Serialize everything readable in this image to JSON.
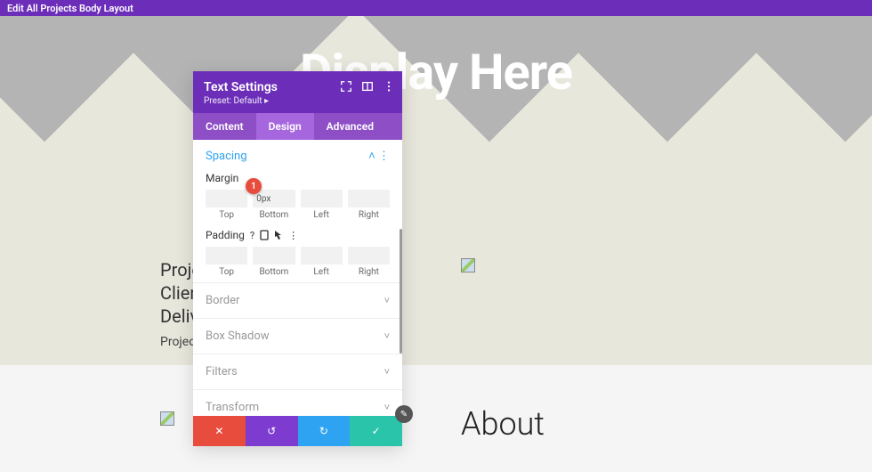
{
  "topBar": {
    "title": "Edit All Projects Body Layout"
  },
  "hero": {
    "title": "Display Here"
  },
  "leftText": {
    "lines": [
      "Projec",
      "Client",
      "Delive"
    ],
    "sub": "Project "
  },
  "about": {
    "heading": "About"
  },
  "modal": {
    "title": "Text Settings",
    "preset": "Preset: Default ▸",
    "tabs": {
      "content": "Content",
      "design": "Design",
      "advanced": "Advanced"
    },
    "activeTab": "design",
    "spacing": {
      "label": "Spacing",
      "margin": {
        "label": "Margin",
        "top": {
          "value": "",
          "label": "Top"
        },
        "bottom": {
          "value": "0px",
          "label": "Bottom"
        },
        "left": {
          "value": "",
          "label": "Left"
        },
        "right": {
          "value": "",
          "label": "Right"
        }
      },
      "padding": {
        "label": "Padding",
        "top": {
          "value": "",
          "label": "Top"
        },
        "bottom": {
          "value": "",
          "label": "Bottom"
        },
        "left": {
          "value": "",
          "label": "Left"
        },
        "right": {
          "value": "",
          "label": "Right"
        }
      }
    },
    "collapsed": {
      "border": "Border",
      "boxShadow": "Box Shadow",
      "filters": "Filters",
      "transform": "Transform"
    },
    "marker1": "1"
  },
  "icons": {
    "expand": "expand-icon",
    "preview": "preview-icon",
    "more": "more-icon",
    "help": "?",
    "mobile": "mobile",
    "hover": "hover",
    "kebab": "⋮",
    "chevUp": "˄",
    "chevDown": "˅",
    "link": "⧉",
    "close": "✕",
    "undo": "↺",
    "redo": "↻",
    "check": "✓",
    "pencil": "✎"
  }
}
